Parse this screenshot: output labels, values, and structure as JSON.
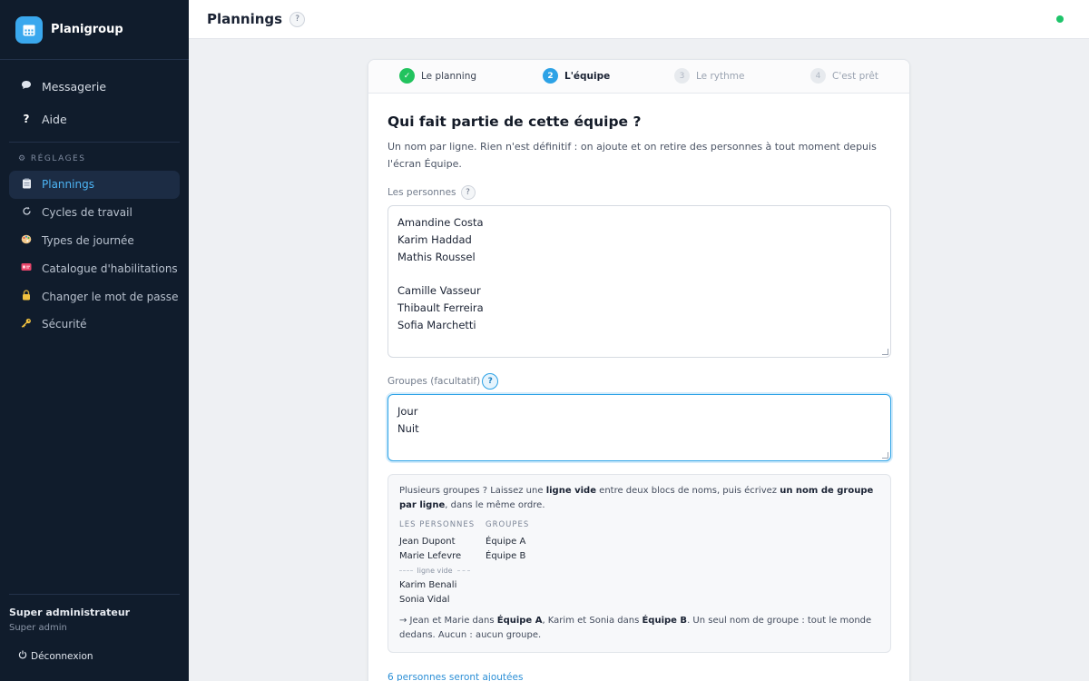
{
  "app": {
    "name": "Planigroup",
    "logo_icon": "calendar-icon",
    "accent": "#3aa8ee"
  },
  "sidebar": {
    "top_items": [
      {
        "label": "Messagerie",
        "icon": "chat-bubble-icon"
      },
      {
        "label": "Aide",
        "icon": "question-icon"
      }
    ],
    "settings_title": "⚙ RÉGLAGES",
    "settings_items": [
      {
        "label": "Plannings",
        "icon": "clipboard-icon",
        "active": true
      },
      {
        "label": "Cycles de travail",
        "icon": "cycle-icon"
      },
      {
        "label": "Types de journée",
        "icon": "palette-icon"
      },
      {
        "label": "Catalogue d'habilitations",
        "icon": "badge-icon"
      },
      {
        "label": "Changer le mot de passe",
        "icon": "lock-icon"
      },
      {
        "label": "Sécurité",
        "icon": "key-icon"
      }
    ],
    "user": {
      "name": "Super administrateur",
      "role": "Super admin"
    },
    "logout_label": "Déconnexion"
  },
  "header": {
    "title": "Plannings",
    "help": "?",
    "status_color": "#1ec46a"
  },
  "stepper": {
    "steps": [
      {
        "num": "✓",
        "label": "Le planning",
        "state": "done"
      },
      {
        "num": "2",
        "label": "L'équipe",
        "state": "active"
      },
      {
        "num": "3",
        "label": "Le rythme",
        "state": "todo"
      },
      {
        "num": "4",
        "label": "C'est prêt",
        "state": "todo"
      }
    ]
  },
  "form": {
    "title": "Qui fait partie de cette équipe ?",
    "description": "Un nom par ligne. Rien n'est définitif : on ajoute et on retire des personnes à tout moment depuis l'écran Équipe.",
    "people_label": "Les personnes",
    "people_help": "?",
    "people_lines": [
      "Amandine Costa",
      "Karim Haddad",
      "Mathis Roussel",
      "",
      "Camille Vasseur",
      "Thibault Ferreira",
      "Sofia Marchetti"
    ],
    "groups_label": "Groupes (facultatif)",
    "groups_help": "?",
    "groups_lines": [
      "Jour",
      "Nuit"
    ],
    "info": {
      "intro_1": "Plusieurs groupes ? Laissez une ",
      "intro_b1": "ligne vide",
      "intro_2": " entre deux blocs de noms, puis écrivez ",
      "intro_b2": "un nom de groupe par ligne",
      "intro_3": ", dans le même ordre.",
      "col_people": "LES PERSONNES",
      "col_groups": "GROUPES",
      "people_block_1": [
        "Jean Dupont",
        "Marie Lefevre"
      ],
      "blank_label": "ligne vide",
      "people_block_2": [
        "Karim Benali",
        "Sonia Vidal"
      ],
      "groups": [
        "Équipe A",
        "Équipe B"
      ],
      "note_1": "→ Jean et Marie dans ",
      "note_b1": "Équipe A",
      "note_2": ", Karim et Sonia dans ",
      "note_b2": "Équipe B",
      "note_3": ". Un seul nom de groupe : tout le monde dedans. Aucun : aucun groupe."
    },
    "footer_text": "6 personnes seront ajoutées"
  }
}
